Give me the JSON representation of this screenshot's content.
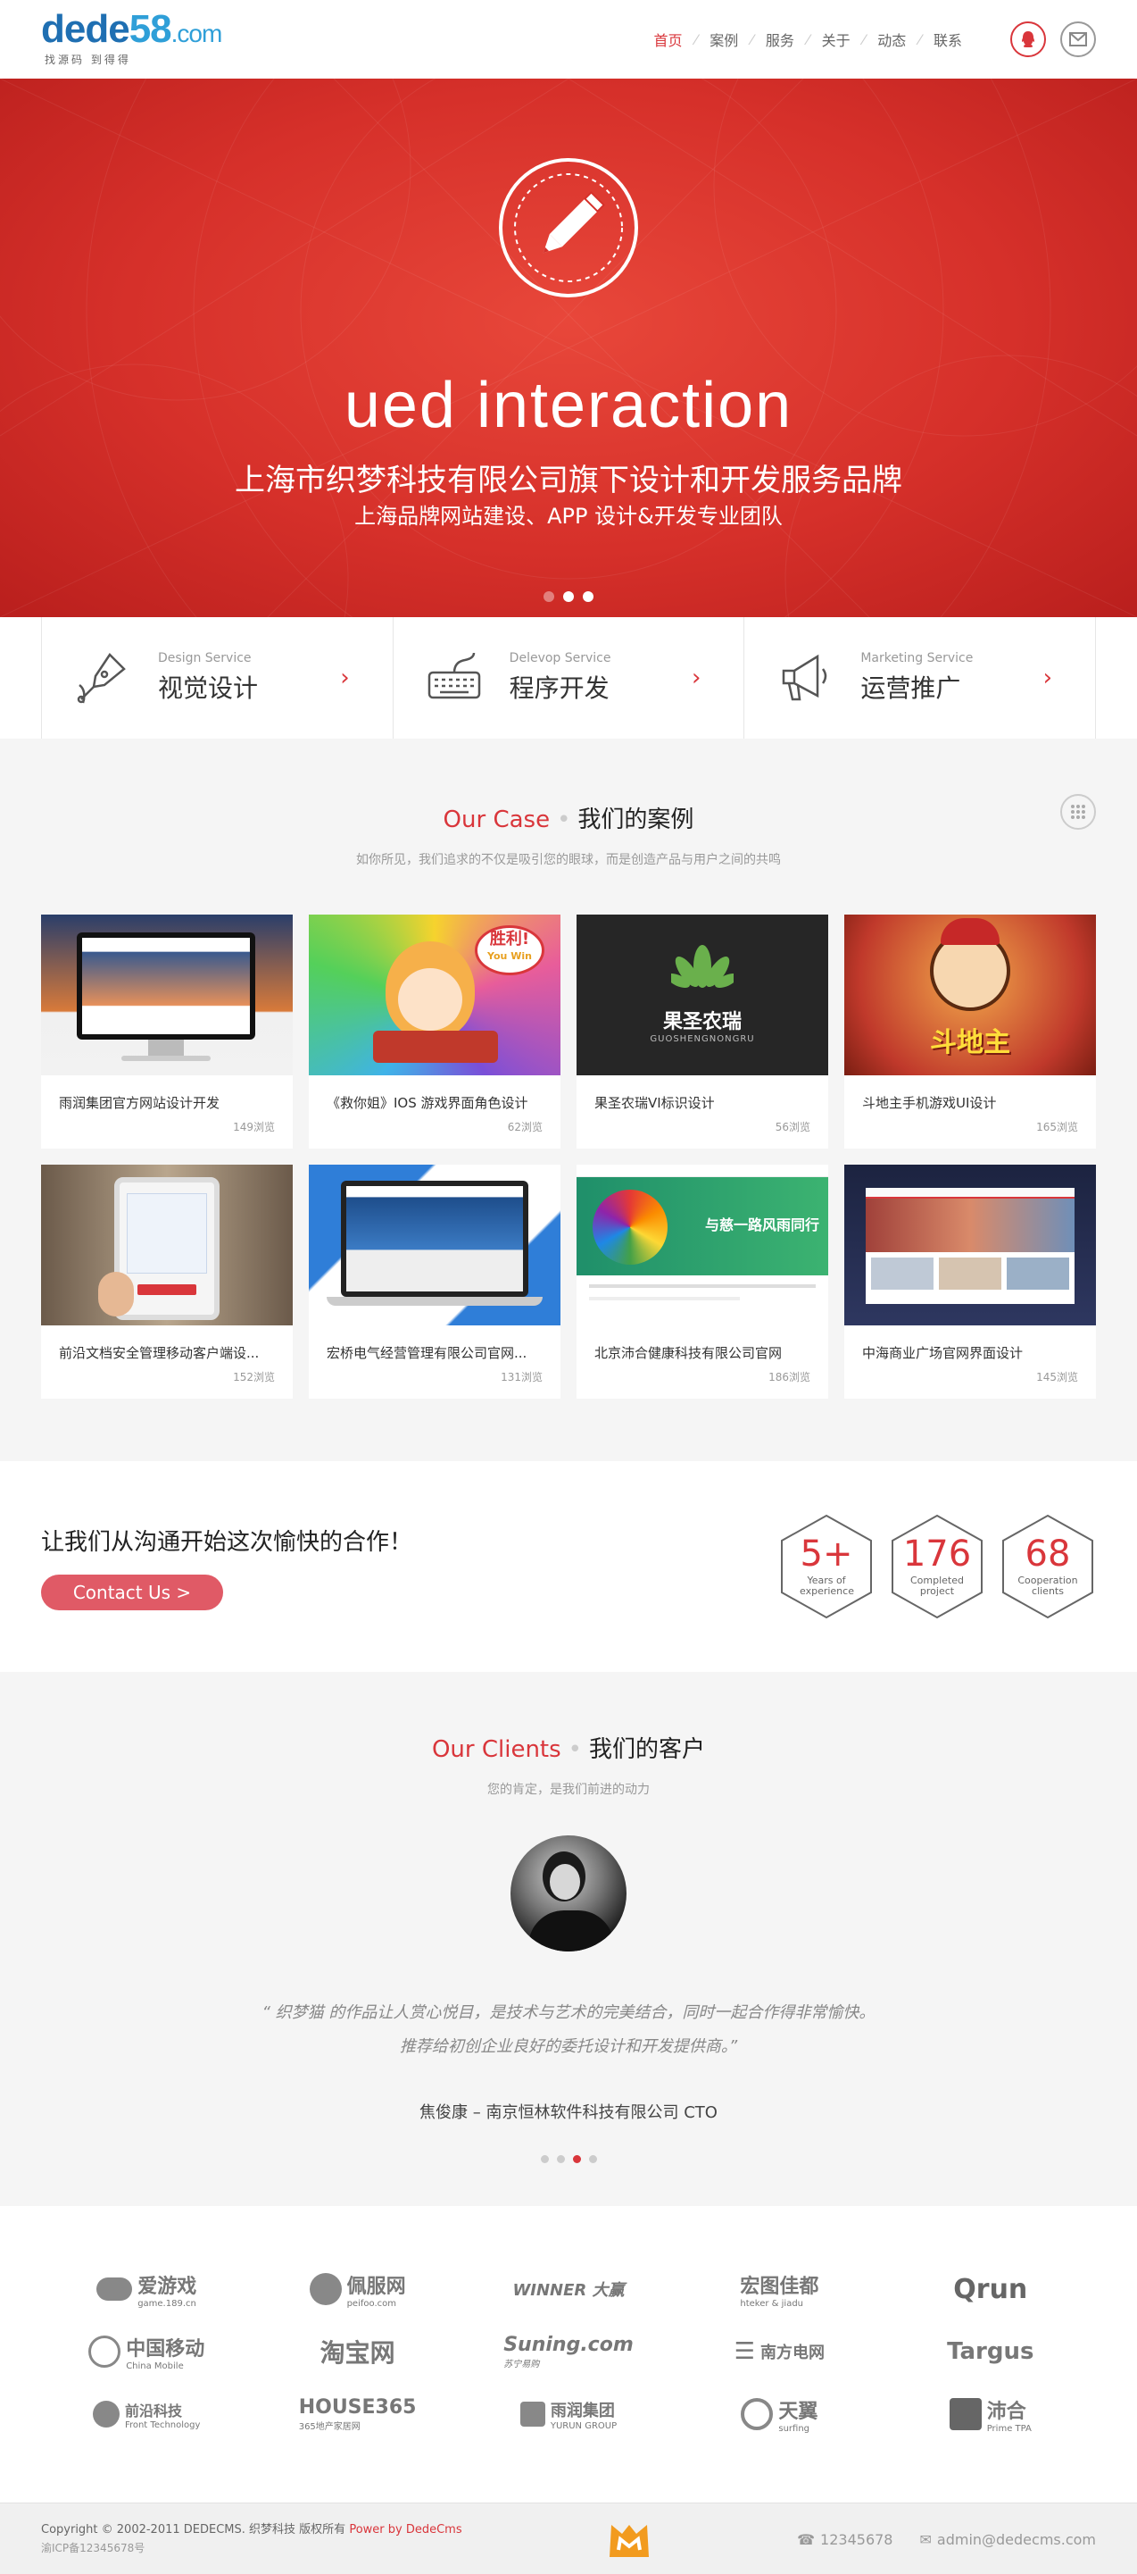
{
  "header": {
    "logo_text": "dede58",
    "logo_domain": ".com",
    "logo_tagline": "找源码 到得得",
    "nav": [
      "首页",
      "案例",
      "服务",
      "关于",
      "动态",
      "联系"
    ],
    "active_index": 0,
    "icons": [
      "qq-icon",
      "mail-icon"
    ]
  },
  "hero": {
    "title_en": "ued interaction",
    "title_cn": "上海市织梦科技有限公司旗下设计和开发服务品牌",
    "subtitle_cn": "上海品牌网站建设、APP 设计&开发专业团队",
    "active_slide": 1,
    "slides": 3
  },
  "services": [
    {
      "en": "Design Service",
      "cn": "视觉设计",
      "icon": "pen-icon"
    },
    {
      "en": "Delevop Service",
      "cn": "程序开发",
      "icon": "keyboard-icon"
    },
    {
      "en": "Marketing Service",
      "cn": "运营推广",
      "icon": "megaphone-icon"
    }
  ],
  "case": {
    "title_en": "Our Case",
    "title_cn": "我们的案例",
    "subtitle": "如你所见，我们追求的不仅是吸引您的眼球，而是创造产品与用户之间的共鸣",
    "items": [
      {
        "title": "雨润集团官方网站设计开发",
        "views": "149浏览"
      },
      {
        "title": "《救你姐》IOS 游戏界面角色设计",
        "views": "62浏览"
      },
      {
        "title": "果圣农瑞VI标识设计",
        "views": "56浏览"
      },
      {
        "title": "斗地主手机游戏UI设计",
        "views": "165浏览"
      },
      {
        "title": "前沿文档安全管理移动客户端设...",
        "views": "152浏览"
      },
      {
        "title": "宏桥电气经营管理有限公司官网...",
        "views": "131浏览"
      },
      {
        "title": "北京沛合健康科技有限公司官网",
        "views": "186浏览"
      },
      {
        "title": "中海商业广场官网界面设计",
        "views": "145浏览"
      }
    ],
    "thumb_texts": {
      "badge": "胜利!",
      "badge_en": "You Win",
      "brand_cn": "果圣农瑞",
      "brand_en": "GUOSHENGNONGRU",
      "landlord": "斗地主",
      "peihe": "与慈一路风雨同行"
    }
  },
  "cta": {
    "text": "让我们从沟通开始这次愉快的合作！",
    "button": "Contact Us >",
    "stats": [
      {
        "num": "5+",
        "label": "Years of experience"
      },
      {
        "num": "176",
        "label": "Completed project"
      },
      {
        "num": "68",
        "label": "Cooperation clients"
      }
    ]
  },
  "clients": {
    "title_en": "Our Clients",
    "title_cn": "我们的客户",
    "subtitle": "您的肯定，是我们前进的动力",
    "quote": "“ 织梦猫 的作品让人赏心悦目，是技术与艺术的完美结合，同时一起合作得非常愉快。推荐给初创企业良好的委托设计和开发提供商。”",
    "person": "焦俊康 – 南京恒林软件科技有限公司 CTO",
    "dots": 4,
    "active_dot": 2
  },
  "partners": [
    {
      "name": "爱游戏",
      "sub": "game.189.cn"
    },
    {
      "name": "佩服网",
      "sub": "peifoo.com"
    },
    {
      "name": "WINNER 大赢",
      "sub": ""
    },
    {
      "name": "宏图佳都",
      "sub": "hteker & jiadu"
    },
    {
      "name": "Qrun",
      "sub": ""
    },
    {
      "name": "中国移动",
      "sub": "China Mobile"
    },
    {
      "name": "淘宝网",
      "sub": ""
    },
    {
      "name": "Suning.com",
      "sub": "苏宁易购"
    },
    {
      "name": "南方电网",
      "sub": ""
    },
    {
      "name": "Targus",
      "sub": ""
    },
    {
      "name": "前沿科技",
      "sub": "Front Technology"
    },
    {
      "name": "HOUSE365",
      "sub": "365地产家居网"
    },
    {
      "name": "雨润集团",
      "sub": "YURUN GROUP"
    },
    {
      "name": "天翼",
      "sub": "surfing"
    },
    {
      "name": "沛合",
      "sub": "Prime TPA"
    }
  ],
  "footer": {
    "copyright": "Copyright © 2002-2011 DEDECMS. 织梦科技 版权所有",
    "power": "Power by DedeCms",
    "icp": "渝ICP备12345678号",
    "phone": "12345678",
    "email": "admin@dedecms.com"
  },
  "colors": {
    "accent": "#d9363b",
    "hero": "#d6302a",
    "button": "#e05a66"
  }
}
